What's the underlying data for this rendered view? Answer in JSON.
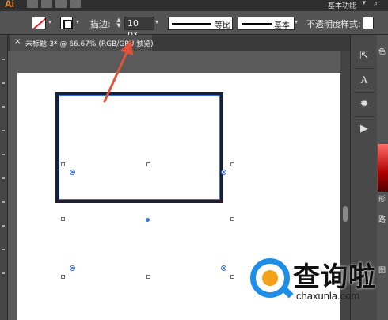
{
  "menubar": {
    "app_logo": "Ai",
    "workspace": "基本功能",
    "arrow": "▾"
  },
  "controlbar": {
    "stroke_label": "描边:",
    "stroke_weight": "10 px",
    "profile_label": "等比",
    "brush_label": "基本",
    "opacity_label": "不透明度",
    "style_label": "样式:",
    "arrow": "▾"
  },
  "document": {
    "tab_title": "未标题-3* @ 66.67% (RGB/GPU 预览)",
    "close": "×"
  },
  "side_panel": {
    "item_color": "色",
    "item_shape": "形",
    "item_path": "路",
    "item_layers": "图"
  },
  "watermark": {
    "title": "查询啦",
    "domain": "chaxunla.com"
  },
  "colors": {
    "annotation_arrow": "#e0533a",
    "selection": "#3b72d6",
    "stroke": "#1b2130"
  },
  "icons": {
    "panel_buttons": [
      "expand-icon",
      "character-icon",
      "appearance-icon",
      "play-icon"
    ]
  }
}
